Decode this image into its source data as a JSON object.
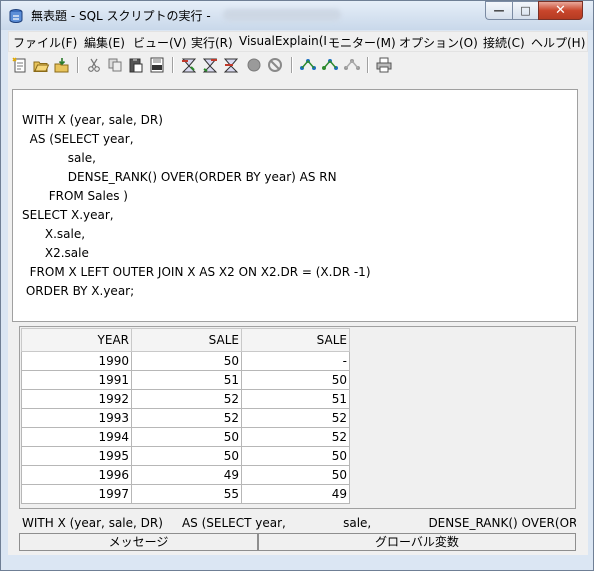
{
  "window": {
    "title": "無表題 - SQL スクリプトの実行 -",
    "controls": {
      "minimize": "—",
      "maximize": "□",
      "close": "✕"
    }
  },
  "menu": [
    "ファイル(F)",
    "編集(E)",
    "ビュー(V)",
    "実行(R)",
    "VisualExplain(I",
    "モニター(M)",
    "オプション(O)",
    "接続(C)",
    "ヘルプ(H)"
  ],
  "toolbar_icons": [
    "new-script-icon",
    "open-icon",
    "save-icon",
    "cut-icon",
    "copy-icon",
    "paste-icon",
    "sql-export-icon",
    "run-all-icon",
    "run-from-cursor-icon",
    "run-selected-icon",
    "stop-icon",
    "cancel-icon",
    "explain-icon",
    "explain-run-icon",
    "explain-disabled-icon",
    "print-icon"
  ],
  "editor": {
    "lines": [
      "WITH X (year, sale, DR)",
      "  AS (SELECT year,",
      "            sale,",
      "            DENSE_RANK() OVER(ORDER BY year) AS RN",
      "       FROM Sales )",
      "SELECT X.year,",
      "      X.sale,",
      "      X2.sale",
      "  FROM X LEFT OUTER JOIN X AS X2 ON X2.DR = (X.DR -1)",
      " ORDER BY X.year;"
    ]
  },
  "results": {
    "columns": [
      "YEAR",
      "SALE",
      "SALE"
    ],
    "rows": [
      [
        "1990",
        "50",
        "-"
      ],
      [
        "1991",
        "51",
        "50"
      ],
      [
        "1992",
        "52",
        "51"
      ],
      [
        "1993",
        "52",
        "52"
      ],
      [
        "1994",
        "50",
        "52"
      ],
      [
        "1995",
        "50",
        "50"
      ],
      [
        "1996",
        "49",
        "50"
      ],
      [
        "1997",
        "55",
        "49"
      ]
    ]
  },
  "status": {
    "text": "WITH X (year, sale, DR)     AS (SELECT year,               sale,               DENSE_RANK() OVER(OR"
  },
  "tabs": {
    "messages": "メッセージ",
    "global_variables": "グローバル変数"
  },
  "colors": {
    "frame": "#dbe6f3",
    "close_button": "#c9462c",
    "panel": "#f0f0f0"
  }
}
